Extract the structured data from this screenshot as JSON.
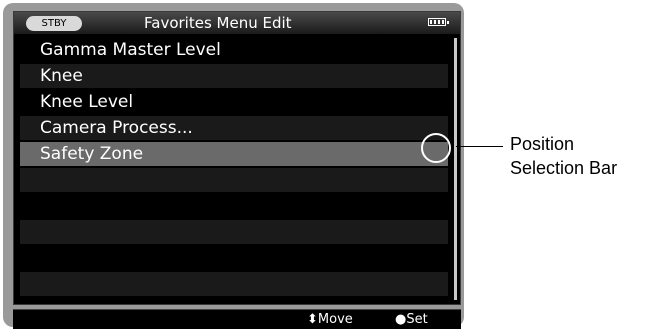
{
  "header": {
    "status_badge": "STBY",
    "title": "Favorites Menu Edit",
    "battery_icon": "battery-icon"
  },
  "menu": {
    "items": [
      {
        "label": "Gamma Master Level",
        "selected": false
      },
      {
        "label": "Knee",
        "selected": false
      },
      {
        "label": "Knee Level",
        "selected": false
      },
      {
        "label": "Camera Process...",
        "selected": false
      },
      {
        "label": "Safety Zone",
        "selected": true
      },
      {
        "label": "",
        "selected": false
      },
      {
        "label": "",
        "selected": false
      },
      {
        "label": "",
        "selected": false
      },
      {
        "label": "",
        "selected": false
      },
      {
        "label": "",
        "selected": false
      }
    ]
  },
  "footer": {
    "move_label": "⬍Move",
    "set_label": "●Set"
  },
  "callout": {
    "line1": "Position",
    "line2": "Selection Bar"
  }
}
